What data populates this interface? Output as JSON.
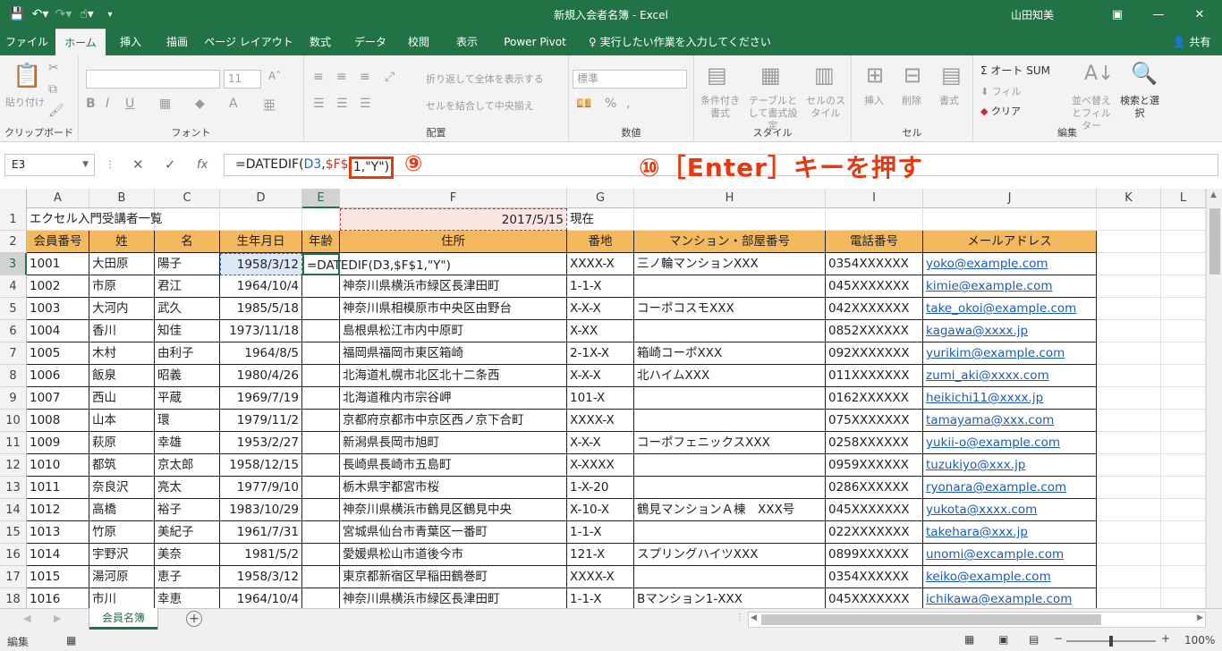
{
  "window": {
    "title": "新規入会者名簿  -  Excel",
    "user": "山田知美",
    "share": "共有"
  },
  "tabs": [
    "ファイル",
    "ホーム",
    "挿入",
    "描画",
    "ページ レイアウト",
    "数式",
    "データ",
    "校閲",
    "表示",
    "Power Pivot",
    "実行したい作業を入力してください"
  ],
  "ribbon": {
    "clipboard": {
      "paste": "貼り付け",
      "label": "クリップボード"
    },
    "font": {
      "size": "11",
      "label": "フォント"
    },
    "alignment": {
      "wrap": "折り返して全体を表示する",
      "merge": "セルを結合して中央揃え",
      "label": "配置"
    },
    "number": {
      "format": "標準",
      "label": "数値"
    },
    "styles": {
      "cond": "条件付き書式",
      "table": "テーブルとして書式設定",
      "cell": "セルのスタイル",
      "label": "スタイル"
    },
    "cells": {
      "insert": "挿入",
      "delete": "削除",
      "format": "書式",
      "label": "セル"
    },
    "editing": {
      "autosum": "オート SUM",
      "fill": "フィル",
      "clear": "クリア",
      "sort": "並べ替えとフィルター",
      "find": "検索と選択",
      "label": "編集"
    }
  },
  "formula_bar": {
    "namebox": "E3",
    "prefix": "=DATEDIF(",
    "ref1": "D3",
    "sep": ",",
    "ref2": "$F$",
    "box_text": "1,\"Y\")",
    "mark9": "⑨",
    "annotation10": "⑩［Enter］キーを押す"
  },
  "columns": [
    "A",
    "B",
    "C",
    "D",
    "E",
    "F",
    "G",
    "H",
    "I",
    "J",
    "K",
    "L"
  ],
  "row_numbers": [
    "1",
    "2",
    "3",
    "4",
    "5",
    "6",
    "7",
    "8",
    "9",
    "10",
    "11",
    "12",
    "13",
    "14",
    "15",
    "16",
    "17",
    "18"
  ],
  "title_row": {
    "a": "エクセル入門受講者一覧",
    "f": "2017/5/15",
    "g": "現在"
  },
  "headers": [
    "会員番号",
    "姓",
    "名",
    "生年月日",
    "年齢",
    "住所",
    "番地",
    "マンション・部屋番号",
    "電話番号",
    "メールアドレス"
  ],
  "editing_cell": "=DATEDIF(D3,$F$1,\"Y\")",
  "rows": [
    [
      "1001",
      "大田原",
      "陽子",
      "1958/3/12",
      "",
      "",
      "XXXX-X",
      "三ノ輪マンションXXX",
      "0354XXXXXX",
      "yoko@example.com"
    ],
    [
      "1002",
      "市原",
      "君江",
      "1964/10/4",
      "",
      "神奈川県横浜市緑区長津田町",
      "1-1-X",
      "",
      "045XXXXXXX",
      "kimie@example.com"
    ],
    [
      "1003",
      "大河内",
      "武久",
      "1985/5/18",
      "",
      "神奈川県相模原市中央区由野台",
      "X-X-X",
      "コーポコスモXXX",
      "042XXXXXXX",
      "take_okoi@example.com"
    ],
    [
      "1004",
      "香川",
      "知佳",
      "1973/11/18",
      "",
      "島根県松江市内中原町",
      "X-XX",
      "",
      "0852XXXXXX",
      "kagawa@xxxx.jp"
    ],
    [
      "1005",
      "木村",
      "由利子",
      "1964/8/5",
      "",
      "福岡県福岡市東区箱崎",
      "2-1X-X",
      "箱崎コーポXXX",
      "092XXXXXXX",
      "yurikim@example.com"
    ],
    [
      "1006",
      "飯泉",
      "昭義",
      "1980/4/26",
      "",
      "北海道札幌市北区北十二条西",
      "X-X-X",
      "北ハイムXXX",
      "011XXXXXXX",
      "zumi_aki@xxxx.com"
    ],
    [
      "1007",
      "西山",
      "平蔵",
      "1969/7/19",
      "",
      "北海道稚内市宗谷岬",
      "101-X",
      "",
      "0162XXXXXX",
      "heikichi11@xxxx.jp"
    ],
    [
      "1008",
      "山本",
      "環",
      "1979/11/2",
      "",
      "京都府京都市中京区西ノ京下合町",
      "XXXX-X",
      "",
      "075XXXXXXX",
      "tamayama@xxx.com"
    ],
    [
      "1009",
      "萩原",
      "幸雄",
      "1953/2/27",
      "",
      "新潟県長岡市旭町",
      "X-X-X",
      "コーポフェニックスXXX",
      "0258XXXXXX",
      "yukii-o@example.com"
    ],
    [
      "1010",
      "都筑",
      "京太郎",
      "1958/12/15",
      "",
      "長崎県長崎市五島町",
      "X-XXXX",
      "",
      "0959XXXXXX",
      "tuzukiyo@xxx.jp"
    ],
    [
      "1011",
      "奈良沢",
      "亮太",
      "1977/9/10",
      "",
      "栃木県宇都宮市桜",
      "1-X-20",
      "",
      "0286XXXXXX",
      "ryonara@example.com"
    ],
    [
      "1012",
      "高橋",
      "裕子",
      "1983/10/29",
      "",
      "神奈川県横浜市鶴見区鶴見中央",
      "X-10-X",
      "鶴見マンションＡ棟　XXX号",
      "045XXXXXXX",
      "yukota@xxxx.com"
    ],
    [
      "1013",
      "竹原",
      "美紀子",
      "1961/7/31",
      "",
      "宮城県仙台市青葉区一番町",
      "1-1-X",
      "",
      "022XXXXXXX",
      "takehara@xxx.jp"
    ],
    [
      "1014",
      "宇野沢",
      "美奈",
      "1981/5/2",
      "",
      "愛媛県松山市道後今市",
      "121-X",
      "スプリングハイツXXX",
      "0899XXXXXX",
      "unomi@excample.com"
    ],
    [
      "1015",
      "湯河原",
      "恵子",
      "1958/3/12",
      "",
      "東京都新宿区早稲田鶴巻町",
      "XXXX-X",
      "",
      "0354XXXXXX",
      "keiko@example.com"
    ],
    [
      "1016",
      "市川",
      "幸恵",
      "1964/10/4",
      "",
      "神奈川県横浜市緑区長津田町",
      "1-1-X",
      "Bマンション1-XXX",
      "045XXXXXXX",
      "ichikawa@example.com"
    ]
  ],
  "sheet_tab": "会員名簿",
  "status": {
    "mode": "編集",
    "zoom": "100%"
  }
}
